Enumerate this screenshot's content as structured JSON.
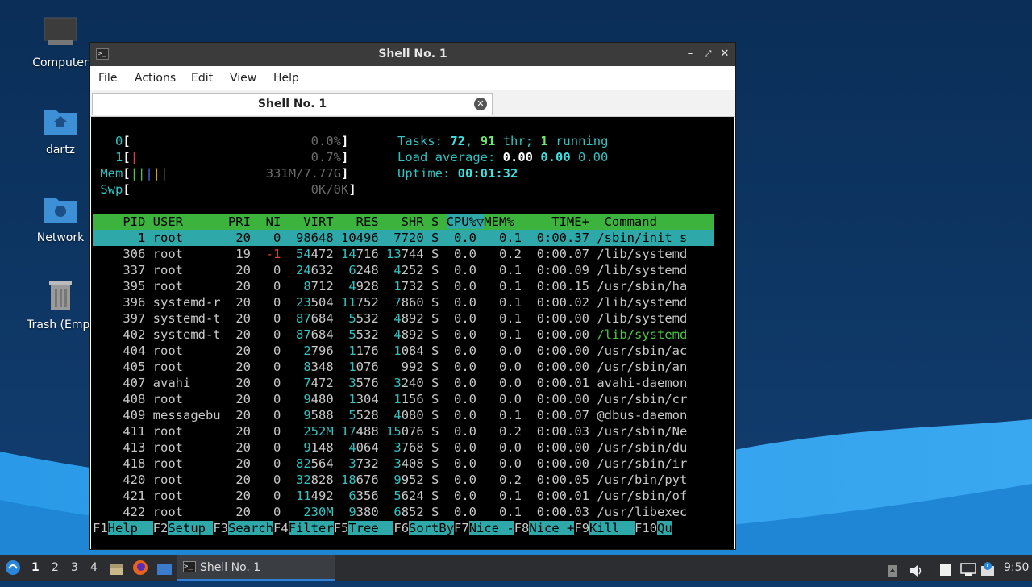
{
  "desktop": {
    "icons": [
      {
        "label": "Computer"
      },
      {
        "label": "dartz"
      },
      {
        "label": "Network"
      },
      {
        "label": "Trash (Empt"
      }
    ]
  },
  "window": {
    "title": "Shell No. 1",
    "menu": [
      "File",
      "Actions",
      "Edit",
      "View",
      "Help"
    ],
    "tab_label": "Shell No. 1"
  },
  "htop": {
    "cpu0": {
      "label": "0",
      "value": "0.0%"
    },
    "cpu1": {
      "label": "1",
      "value": "0.7%"
    },
    "mem": {
      "label": "Mem",
      "value": "331M/7.77G"
    },
    "swp": {
      "label": "Swp",
      "value": "0K/0K"
    },
    "tasks": {
      "label": "Tasks:",
      "tasks": "72",
      "threads": "91",
      "thr_label": "thr;",
      "running": "1",
      "running_label": "running"
    },
    "load": {
      "label": "Load average:",
      "l1": "0.00",
      "l5": "0.00",
      "l15": "0.00"
    },
    "uptime": {
      "label": "Uptime:",
      "value": "00:01:32"
    },
    "columns": {
      "pid": "PID",
      "user": "USER",
      "pri": "PRI",
      "ni": "NI",
      "virt": "VIRT",
      "res": "RES",
      "shr": "SHR",
      "s": "S",
      "cpu": "CPU%▽",
      "mem": "MEM%",
      "time": "TIME+",
      "command": "Command"
    },
    "processes": [
      {
        "pid": "1",
        "user": "root",
        "pri": "20",
        "ni": "0",
        "virt": "98648",
        "res": "10496",
        "shr": "7720",
        "s": "S",
        "cpu": "0.0",
        "mem": "0.1",
        "time": "0:00.37",
        "command": "/sbin/init s"
      },
      {
        "pid": "306",
        "user": "root",
        "pri": "19",
        "ni": "-1",
        "virt": "54472",
        "res": "14716",
        "shr": "13744",
        "s": "S",
        "cpu": "0.0",
        "mem": "0.2",
        "time": "0:00.07",
        "command": "/lib/systemd"
      },
      {
        "pid": "337",
        "user": "root",
        "pri": "20",
        "ni": "0",
        "virt": "24632",
        "res": "6248",
        "shr": "4252",
        "s": "S",
        "cpu": "0.0",
        "mem": "0.1",
        "time": "0:00.09",
        "command": "/lib/systemd"
      },
      {
        "pid": "395",
        "user": "root",
        "pri": "20",
        "ni": "0",
        "virt": "8712",
        "res": "4928",
        "shr": "1732",
        "s": "S",
        "cpu": "0.0",
        "mem": "0.1",
        "time": "0:00.15",
        "command": "/usr/sbin/ha"
      },
      {
        "pid": "396",
        "user": "systemd-r",
        "pri": "20",
        "ni": "0",
        "virt": "23504",
        "res": "11752",
        "shr": "7860",
        "s": "S",
        "cpu": "0.0",
        "mem": "0.1",
        "time": "0:00.02",
        "command": "/lib/systemd"
      },
      {
        "pid": "397",
        "user": "systemd-t",
        "pri": "20",
        "ni": "0",
        "virt": "87684",
        "res": "5532",
        "shr": "4892",
        "s": "S",
        "cpu": "0.0",
        "mem": "0.1",
        "time": "0:00.00",
        "command": "/lib/systemd"
      },
      {
        "pid": "402",
        "user": "systemd-t",
        "pri": "20",
        "ni": "0",
        "virt": "87684",
        "res": "5532",
        "shr": "4892",
        "s": "S",
        "cpu": "0.0",
        "mem": "0.1",
        "time": "0:00.00",
        "command": "/lib/systemd"
      },
      {
        "pid": "404",
        "user": "root",
        "pri": "20",
        "ni": "0",
        "virt": "2796",
        "res": "1176",
        "shr": "1084",
        "s": "S",
        "cpu": "0.0",
        "mem": "0.0",
        "time": "0:00.00",
        "command": "/usr/sbin/ac"
      },
      {
        "pid": "405",
        "user": "root",
        "pri": "20",
        "ni": "0",
        "virt": "8348",
        "res": "1076",
        "shr": "992",
        "s": "S",
        "cpu": "0.0",
        "mem": "0.0",
        "time": "0:00.00",
        "command": "/usr/sbin/an"
      },
      {
        "pid": "407",
        "user": "avahi",
        "pri": "20",
        "ni": "0",
        "virt": "7472",
        "res": "3576",
        "shr": "3240",
        "s": "S",
        "cpu": "0.0",
        "mem": "0.0",
        "time": "0:00.01",
        "command": "avahi-daemon"
      },
      {
        "pid": "408",
        "user": "root",
        "pri": "20",
        "ni": "0",
        "virt": "9480",
        "res": "1304",
        "shr": "1156",
        "s": "S",
        "cpu": "0.0",
        "mem": "0.0",
        "time": "0:00.00",
        "command": "/usr/sbin/cr"
      },
      {
        "pid": "409",
        "user": "messagebu",
        "pri": "20",
        "ni": "0",
        "virt": "9588",
        "res": "5528",
        "shr": "4080",
        "s": "S",
        "cpu": "0.0",
        "mem": "0.1",
        "time": "0:00.07",
        "command": "@dbus-daemon"
      },
      {
        "pid": "411",
        "user": "root",
        "pri": "20",
        "ni": "0",
        "virt": "252M",
        "res": "17488",
        "shr": "15076",
        "s": "S",
        "cpu": "0.0",
        "mem": "0.2",
        "time": "0:00.03",
        "command": "/usr/sbin/Ne"
      },
      {
        "pid": "413",
        "user": "root",
        "pri": "20",
        "ni": "0",
        "virt": "9148",
        "res": "4064",
        "shr": "3768",
        "s": "S",
        "cpu": "0.0",
        "mem": "0.0",
        "time": "0:00.00",
        "command": "/usr/sbin/du"
      },
      {
        "pid": "418",
        "user": "root",
        "pri": "20",
        "ni": "0",
        "virt": "82564",
        "res": "3732",
        "shr": "3408",
        "s": "S",
        "cpu": "0.0",
        "mem": "0.0",
        "time": "0:00.00",
        "command": "/usr/sbin/ir"
      },
      {
        "pid": "420",
        "user": "root",
        "pri": "20",
        "ni": "0",
        "virt": "32828",
        "res": "18676",
        "shr": "9952",
        "s": "S",
        "cpu": "0.0",
        "mem": "0.2",
        "time": "0:00.05",
        "command": "/usr/bin/pyt"
      },
      {
        "pid": "421",
        "user": "root",
        "pri": "20",
        "ni": "0",
        "virt": "11492",
        "res": "6356",
        "shr": "5624",
        "s": "S",
        "cpu": "0.0",
        "mem": "0.1",
        "time": "0:00.01",
        "command": "/usr/sbin/of"
      },
      {
        "pid": "422",
        "user": "root",
        "pri": "20",
        "ni": "0",
        "virt": "230M",
        "res": "9380",
        "shr": "6852",
        "s": "S",
        "cpu": "0.0",
        "mem": "0.1",
        "time": "0:00.03",
        "command": "/usr/libexec"
      }
    ],
    "fkeys": [
      {
        "key": "F1",
        "label": "Help  "
      },
      {
        "key": "F2",
        "label": "Setup "
      },
      {
        "key": "F3",
        "label": "Search"
      },
      {
        "key": "F4",
        "label": "Filter"
      },
      {
        "key": "F5",
        "label": "Tree  "
      },
      {
        "key": "F6",
        "label": "SortBy"
      },
      {
        "key": "F7",
        "label": "Nice -"
      },
      {
        "key": "F8",
        "label": "Nice +"
      },
      {
        "key": "F9",
        "label": "Kill  "
      },
      {
        "key": "F10",
        "label": "Qu"
      }
    ]
  },
  "taskbar": {
    "workspaces": [
      "1",
      "2",
      "3",
      "4"
    ],
    "active_task": "Shell No. 1",
    "clock": "9:50"
  }
}
